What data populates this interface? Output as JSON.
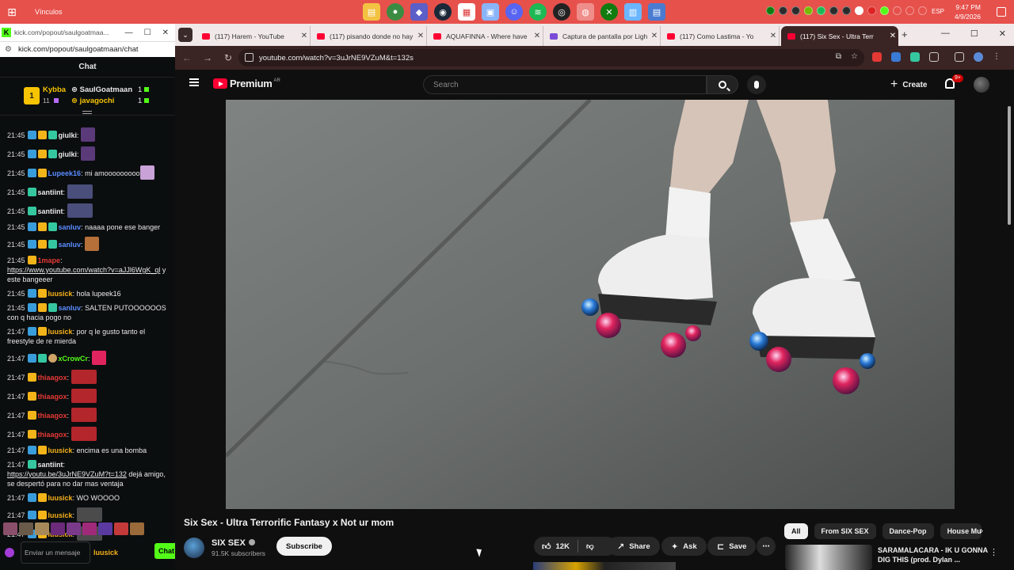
{
  "taskbar": {
    "window_title": "Vínculos",
    "language": "ESP",
    "time": "9:47 PM",
    "date": "4/9/2026",
    "pinned_apps": [
      "file-explorer",
      "chrome",
      "teams",
      "steam",
      "calendar",
      "photos",
      "discord",
      "spotify",
      "obs",
      "chrome-active",
      "xbox",
      "notes",
      "calculator"
    ]
  },
  "kick": {
    "url_title": "kick.com/popout/saulgoatmaa...",
    "url": "kick.com/popout/saulgoatmaan/chat",
    "chat_header": "Chat",
    "pinned": {
      "rank": "1",
      "top_user": "Kybba",
      "top_count": "11",
      "user2": "SaulGoatmaan",
      "user2_count": "1",
      "user3": "javagochi",
      "user3_count": "1"
    },
    "messages": [
      {
        "time": "21:45",
        "user": "giulki",
        "text": "",
        "color": "#e8e8e8",
        "badges": [
          "b",
          "y",
          "g"
        ],
        "emote": "#5b3a7a"
      },
      {
        "time": "21:45",
        "user": "giulki",
        "text": "",
        "color": "#e8e8e8",
        "badges": [
          "b",
          "y",
          "g"
        ],
        "emote": "#5b3a7a"
      },
      {
        "time": "21:45",
        "user": "Lupeek16",
        "text": "mi amooooooooo",
        "color": "#5a8bff",
        "badges": [
          "b",
          "y"
        ],
        "emote": "#c9a2d8"
      },
      {
        "time": "21:45",
        "user": "santiint",
        "text": "",
        "color": "#e8e8e8",
        "badges": [
          "g"
        ],
        "emote": "#4a4e7a",
        "wide": true
      },
      {
        "time": "21:45",
        "user": "santiint",
        "text": "",
        "color": "#e8e8e8",
        "badges": [
          "g"
        ],
        "emote": "#4a4e7a",
        "wide": true
      },
      {
        "time": "21:45",
        "user": "sanluv",
        "text": "naaaa pone ese banger",
        "color": "#5a8bff",
        "badges": [
          "b",
          "y",
          "g"
        ]
      },
      {
        "time": "21:45",
        "user": "sanluv",
        "text": "",
        "color": "#5a8bff",
        "badges": [
          "b",
          "y",
          "g"
        ],
        "emote": "#b5703a"
      },
      {
        "time": "21:45",
        "user": "1mape",
        "text": "",
        "link": "https://www.youtube.com/watch?v=aJJl6WgK_ql",
        "after": " y este bangeeer",
        "color": "#e53935",
        "badges": [
          "y"
        ]
      },
      {
        "time": "21:45",
        "user": "luusick",
        "text": "hola lupeek16",
        "color": "#f6b11a",
        "badges": [
          "b",
          "y"
        ]
      },
      {
        "time": "21:45",
        "user": "sanluv",
        "text": "SALTEN PUTOOOOOOS con q hacia pogo no",
        "color": "#5a8bff",
        "badges": [
          "b",
          "y",
          "g"
        ]
      },
      {
        "time": "21:47",
        "user": "luusick",
        "text": "por q le gusto tanto el freestyle de re mierda",
        "color": "#f6b11a",
        "badges": [
          "b",
          "y"
        ]
      },
      {
        "time": "21:47",
        "user": "xCrowCr",
        "text": "",
        "color": "#53fc18",
        "badges": [
          "b",
          "g",
          "w"
        ],
        "emote": "#e0245e"
      },
      {
        "time": "21:47",
        "user": "thiaagox",
        "text": "",
        "color": "#e53935",
        "badges": [
          "y"
        ],
        "emote": "#b3262b",
        "wide": true
      },
      {
        "time": "21:47",
        "user": "thiaagox",
        "text": "",
        "color": "#e53935",
        "badges": [
          "y"
        ],
        "emote": "#b3262b",
        "wide": true
      },
      {
        "time": "21:47",
        "user": "thiaagox",
        "text": "",
        "color": "#e53935",
        "badges": [
          "y"
        ],
        "emote": "#b3262b",
        "wide": true
      },
      {
        "time": "21:47",
        "user": "thiaagox",
        "text": "",
        "color": "#e53935",
        "badges": [
          "y"
        ],
        "emote": "#b3262b",
        "wide": true
      },
      {
        "time": "21:47",
        "user": "luusick",
        "text": "encima es una bomba",
        "color": "#f6b11a",
        "badges": [
          "b",
          "y"
        ]
      },
      {
        "time": "21:47",
        "user": "santiint",
        "text": "",
        "link": "https://youtu.be/3uJrNE9VZuM?t=132",
        "after": " dejá amigo, se despertó para no dar mas ventaja",
        "color": "#e8e8e8",
        "badges": [
          "g"
        ]
      },
      {
        "time": "21:47",
        "user": "luusick",
        "text": "WO WOOOO",
        "color": "#f6b11a",
        "badges": [
          "b",
          "y"
        ]
      },
      {
        "time": "21:47",
        "user": "luusick",
        "text": "",
        "color": "#f6b11a",
        "badges": [
          "b",
          "y"
        ],
        "emote": "#4b4b4b",
        "wide": true
      },
      {
        "time": "21:47",
        "user": "luusick",
        "text": "",
        "color": "#f6b11a",
        "badges": [
          "b",
          "y"
        ],
        "emote": "#4b4b4b",
        "wide": true
      }
    ],
    "input_placeholder": "Enviar un mensaje",
    "typing_user": "luusick",
    "send_label": "Chat"
  },
  "chrome": {
    "tabs": [
      {
        "label": "(117) Harem - YouTube",
        "fav": "#ff0033"
      },
      {
        "label": "(117) pisando donde no hay",
        "fav": "#ff0033"
      },
      {
        "label": "AQUAFINNA - Where have",
        "fav": "#ff0033"
      },
      {
        "label": "Captura de pantalla por Ligh",
        "fav": "#7b4bd8"
      },
      {
        "label": "(117) Como Lastima - Yo",
        "fav": "#ff0033"
      },
      {
        "label": "(117) Six Sex - Ultra Terr",
        "fav": "#ff0033",
        "active": true
      }
    ],
    "url": "youtube.com/watch?v=3uJrNE9VZuM&t=132s"
  },
  "youtube": {
    "brand": "Premium",
    "region": "AR",
    "search_placeholder": "Search",
    "create_label": "Create",
    "notif_badge": "9+",
    "video_title": "Six Sex - Ultra Terrorific Fantasy x Not ur mom",
    "channel": "SIX SEX",
    "subscribers": "91.5K subscribers",
    "subscribe_label": "Subscribe",
    "likes": "12K",
    "share_label": "Share",
    "ask_label": "Ask",
    "save_label": "Save",
    "chips": [
      "All",
      "From SIX SEX",
      "Dance-Pop",
      "House Mu"
    ],
    "rec_title": "SARAMALACARA - IK U GONNA DIG THIS (prod. Dylan ..."
  }
}
